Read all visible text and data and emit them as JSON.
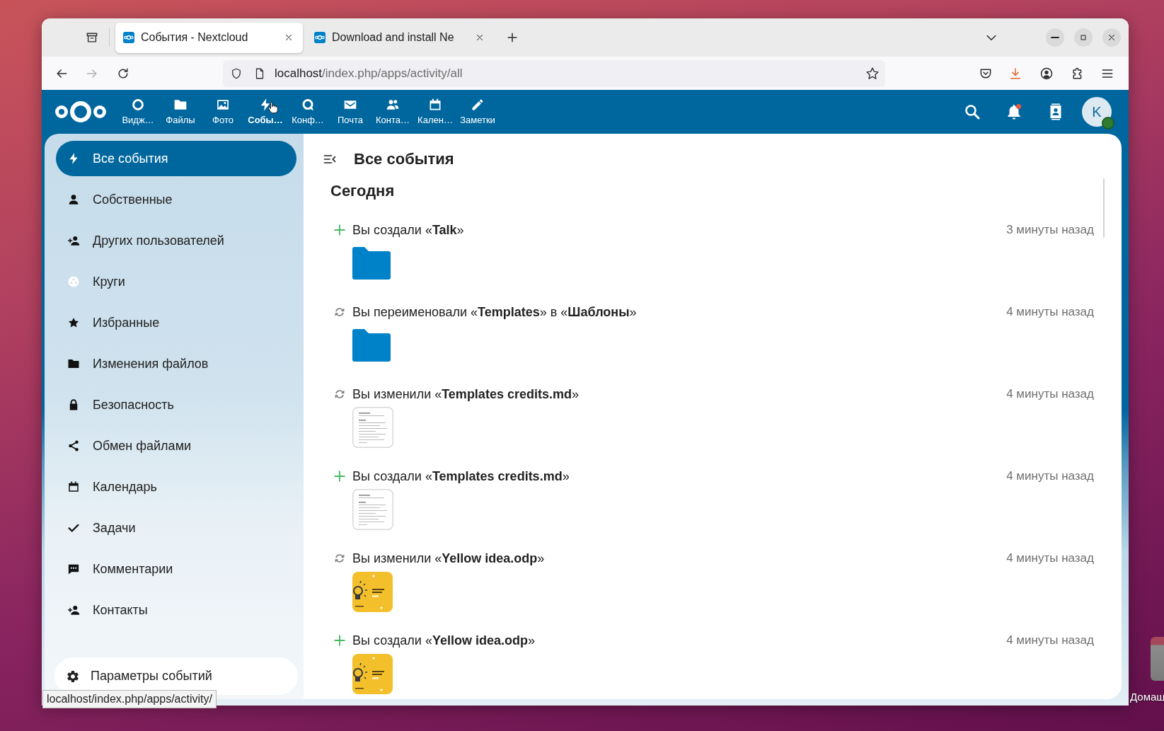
{
  "desktop": {
    "icon_label": "Домаш"
  },
  "browser": {
    "tabs": [
      {
        "title": "События - Nextcloud",
        "selected": true
      },
      {
        "title": "Download and install Ne",
        "selected": false
      }
    ],
    "back_disabled": false,
    "forward_disabled": true,
    "address": {
      "host": "localhost",
      "path": "/index.php/apps/activity/all"
    },
    "download_active": true,
    "status_url": "localhost/index.php/apps/activity/"
  },
  "header": {
    "apps": [
      {
        "label": "Видж…",
        "selected": false
      },
      {
        "label": "Файлы",
        "selected": false
      },
      {
        "label": "Фото",
        "selected": false
      },
      {
        "label": "Собы…",
        "selected": true
      },
      {
        "label": "Конф…",
        "selected": false
      },
      {
        "label": "Почта",
        "selected": false
      },
      {
        "label": "Конта…",
        "selected": false
      },
      {
        "label": "Кален…",
        "selected": false
      },
      {
        "label": "Заметки",
        "selected": false
      }
    ],
    "notifications": {
      "unread": true
    },
    "account": {
      "initial": "K",
      "online": true
    }
  },
  "sidebar": {
    "items": [
      {
        "label": "Все события",
        "selected": true
      },
      {
        "label": "Собственные",
        "selected": false
      },
      {
        "label": "Других пользователей",
        "selected": false
      },
      {
        "label": "Круги",
        "selected": false
      },
      {
        "label": "Избранные",
        "selected": false
      },
      {
        "label": "Изменения файлов",
        "selected": false
      },
      {
        "label": "Безопасность",
        "selected": false
      },
      {
        "label": "Обмен файлами",
        "selected": false
      },
      {
        "label": "Календарь",
        "selected": false
      },
      {
        "label": "Задачи",
        "selected": false
      },
      {
        "label": "Комментарии",
        "selected": false
      },
      {
        "label": "Контакты",
        "selected": false
      }
    ],
    "settings_label": "Параметры событий"
  },
  "main": {
    "title": "Все события",
    "section": "Сегодня",
    "activities": [
      {
        "kind": "created",
        "text": "Вы создали «**Talk**»",
        "time": "3 минуты назад",
        "preview": {
          "kind": "folder"
        }
      },
      {
        "kind": "renamed",
        "text": "Вы переименовали «**Templates**» в «**Шаблоны**»",
        "time": "4 минуты назад",
        "preview": {
          "kind": "folder"
        }
      },
      {
        "kind": "changed",
        "text": "Вы изменили «**Templates credits.md**»",
        "time": "4 минуты назад",
        "preview": {
          "kind": "document"
        }
      },
      {
        "kind": "created",
        "text": "Вы создали «**Templates credits.md**»",
        "time": "4 минуты назад",
        "preview": {
          "kind": "document"
        }
      },
      {
        "kind": "changed",
        "text": "Вы изменили «**Yellow idea.odp**»",
        "time": "4 минуты назад",
        "preview": {
          "kind": "presentation"
        }
      },
      {
        "kind": "created",
        "text": "Вы создали «**Yellow idea.odp**»",
        "time": "4 минуты назад",
        "preview": {
          "kind": "presentation"
        }
      }
    ]
  }
}
